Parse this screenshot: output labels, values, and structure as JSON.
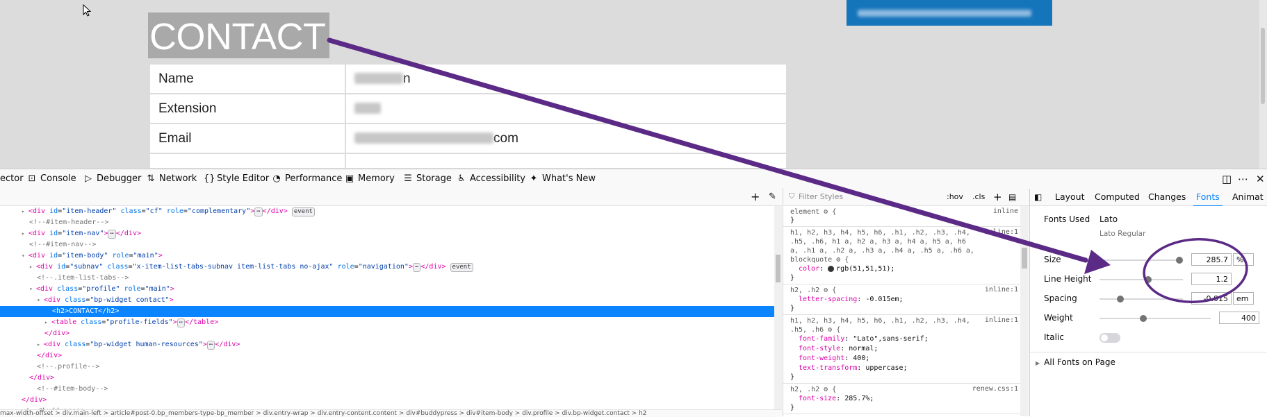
{
  "page": {
    "heading": "CONTACT",
    "fields": [
      {
        "label": "Name",
        "value_suffix": "n"
      },
      {
        "label": "Extension",
        "value_suffix": ""
      },
      {
        "label": "Email",
        "value_suffix": "com"
      }
    ]
  },
  "devtools": {
    "tabs": [
      {
        "label": "ector",
        "icon": "inspector-icon",
        "active": true
      },
      {
        "label": "Console",
        "icon": "console-icon"
      },
      {
        "label": "Debugger",
        "icon": "debugger-icon"
      },
      {
        "label": "Network",
        "icon": "network-icon"
      },
      {
        "label": "Style Editor",
        "icon": "style-editor-icon"
      },
      {
        "label": "Performance",
        "icon": "performance-icon"
      },
      {
        "label": "Memory",
        "icon": "memory-icon"
      },
      {
        "label": "Storage",
        "icon": "storage-icon"
      },
      {
        "label": "Accessibility",
        "icon": "accessibility-icon"
      },
      {
        "label": "What's New",
        "icon": "whats-new-icon"
      }
    ],
    "markup": [
      {
        "html": "<span class=\"tw\">▸</span><span class=\"tag\">&lt;div</span> <span class=\"attr\">id</span>=<span class=\"val\">\"item-header\"</span> <span class=\"attr\">class</span>=<span class=\"val\">\"cf\"</span> <span class=\"attr\">role</span>=<span class=\"val\">\"complementary\"</span><span class=\"tag\">&gt;</span><span class=\"badge\">⋯</span><span class=\"tag\">&lt;/div&gt;</span> <span class=\"badge\">event</span>",
        "indent": 1
      },
      {
        "html": "<span class=\"cmt\">&lt;!--#item-header--&gt;</span>",
        "indent": 2
      },
      {
        "html": "<span class=\"tw\">▸</span><span class=\"tag\">&lt;div</span> <span class=\"attr\">id</span>=<span class=\"val\">\"item-nav\"</span><span class=\"tag\">&gt;</span><span class=\"badge\">⋯</span><span class=\"tag\">&lt;/div&gt;</span>",
        "indent": 1
      },
      {
        "html": "<span class=\"cmt\">&lt;!--#item-nav--&gt;</span>",
        "indent": 2
      },
      {
        "html": "<span class=\"tw\">▾</span><span class=\"tag\">&lt;div</span> <span class=\"attr\">id</span>=<span class=\"val\">\"item-body\"</span> <span class=\"attr\">role</span>=<span class=\"val\">\"main\"</span><span class=\"tag\">&gt;</span>",
        "indent": 1
      },
      {
        "html": "<span class=\"tw\">▸</span><span class=\"tag\">&lt;div</span> <span class=\"attr\">id</span>=<span class=\"val\">\"subnav\"</span> <span class=\"attr\">class</span>=<span class=\"val\">\"x-item-list-tabs-subnav item-list-tabs no-ajax\"</span> <span class=\"attr\">role</span>=<span class=\"val\">\"navigation\"</span><span class=\"tag\">&gt;</span><span class=\"badge\">⋯</span><span class=\"tag\">&lt;/div&gt;</span> <span class=\"badge\">event</span>",
        "indent": 2
      },
      {
        "html": "<span class=\"cmt\">&lt;!--.item-list-tabs--&gt;</span>",
        "indent": 3
      },
      {
        "html": "<span class=\"tw\">▾</span><span class=\"tag\">&lt;div</span> <span class=\"attr\">class</span>=<span class=\"val\">\"profile\"</span> <span class=\"attr\">role</span>=<span class=\"val\">\"main\"</span><span class=\"tag\">&gt;</span>",
        "indent": 2
      },
      {
        "html": "<span class=\"tw\">▾</span><span class=\"tag\">&lt;div</span> <span class=\"attr\">class</span>=<span class=\"val\">\"bp-widget contact\"</span><span class=\"tag\">&gt;</span>",
        "indent": 3
      },
      {
        "html": "<span class=\"tag\">&lt;h2&gt;</span>CONTACT<span class=\"tag\">&lt;/h2&gt;</span>",
        "indent": 5,
        "selected": true
      },
      {
        "html": "<span class=\"tw\">▸</span><span class=\"tag\">&lt;table</span> <span class=\"attr\">class</span>=<span class=\"val\">\"profile-fields\"</span><span class=\"tag\">&gt;</span><span class=\"badge\">⋯</span><span class=\"tag\">&lt;/table&gt;</span>",
        "indent": 4
      },
      {
        "html": "<span class=\"tag\">&lt;/div&gt;</span>",
        "indent": 4
      },
      {
        "html": "<span class=\"tw\">▸</span><span class=\"tag\">&lt;div</span> <span class=\"attr\">class</span>=<span class=\"val\">\"bp-widget human-resources\"</span><span class=\"tag\">&gt;</span><span class=\"badge\">⋯</span><span class=\"tag\">&lt;/div&gt;</span>",
        "indent": 3
      },
      {
        "html": "<span class=\"tag\">&lt;/div&gt;</span>",
        "indent": 3
      },
      {
        "html": "<span class=\"cmt\">&lt;!--.profile--&gt;</span>",
        "indent": 3
      },
      {
        "html": "<span class=\"tag\">&lt;/div&gt;</span>",
        "indent": 2
      },
      {
        "html": "<span class=\"cmt\">&lt;!--#item-body--&gt;</span>",
        "indent": 3
      },
      {
        "html": "<span class=\"tag\">&lt;/div&gt;</span>",
        "indent": 1
      },
      {
        "html": "<span class=\"cmt\">&lt;!--#buddypress--&gt;</span>",
        "indent": 1
      }
    ],
    "breadcrumb": "max-width-offset > div.main-left > article#post-0.bp_members-type-bp_member > div.entry-wrap > div.entry-content.content > div#buddypress > div#item-body > div.profile > div.bp-widget.contact > h2",
    "rules": {
      "filter_placeholder": "Filter Styles",
      "hov": ":hov",
      "cls": ".cls",
      "blocks": [
        {
          "selector": "element",
          "source": "inline",
          "props": []
        },
        {
          "selector": "h1, h2, h3, h4, h5, h6, .h1, .h2, .h3, .h4, .h5, .h6, h1 a, h2 a, h3 a, h4 a, h5 a, h6 a, .h1 a, .h2 a, .h3 a, .h4 a, .h5 a, .h6 a, blockquote",
          "source": "inline:1",
          "props": [
            {
              "name": "color",
              "value": "rgb(51,51,51)",
              "swatch": true
            }
          ]
        },
        {
          "selector": "h2, .h2",
          "source": "inline:1",
          "props": [
            {
              "name": "letter-spacing",
              "value": "-0.015em"
            }
          ]
        },
        {
          "selector": "h1, h2, h3, h4, h5, h6, .h1, .h2, .h3, .h4, .h5, .h6",
          "source": "inline:1",
          "props": [
            {
              "name": "font-family",
              "value": "\"Lato\",sans-serif"
            },
            {
              "name": "font-style",
              "value": "normal"
            },
            {
              "name": "font-weight",
              "value": "400"
            },
            {
              "name": "text-transform",
              "value": "uppercase"
            }
          ]
        },
        {
          "selector": "h2, .h2",
          "source": "renew.css:1",
          "props": [
            {
              "name": "font-size",
              "value": "285.7%"
            }
          ]
        }
      ]
    },
    "fonts": {
      "tabs": [
        "Layout",
        "Computed",
        "Changes",
        "Fonts",
        "Animat"
      ],
      "active_tab": "Fonts",
      "fonts_used_label": "Fonts Used",
      "font_name": "Lato",
      "font_subname": "Lato Regular",
      "size_label": "Size",
      "size_value": "285.7",
      "size_unit": "%",
      "line_height_label": "Line Height",
      "line_height_value": "1.2",
      "spacing_label": "Spacing",
      "spacing_value": "-0.015",
      "spacing_unit": "em",
      "weight_label": "Weight",
      "weight_value": "400",
      "italic_label": "Italic",
      "all_fonts_label": "All Fonts on Page"
    }
  },
  "annotation": {
    "color": "#5b2a86"
  }
}
